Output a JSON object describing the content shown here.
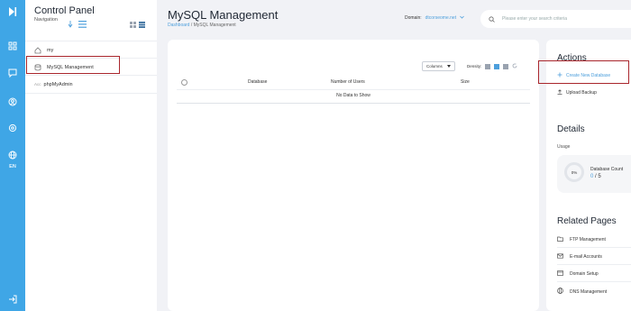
{
  "rail": {
    "items": [
      "expand-icon",
      "grid-icon",
      "chat-icon",
      "user-icon",
      "settings-icon",
      "globe-icon",
      "logout-icon"
    ],
    "lang": "EN"
  },
  "panel": {
    "title": "Control Panel",
    "nav_label": "Navigation",
    "items": [
      {
        "label": "my",
        "icon": "home-icon"
      },
      {
        "label": "MySQL Management",
        "icon": "database-icon"
      },
      {
        "label": "phpMyAdmin",
        "icon": "php-icon",
        "prefix": "Acc"
      }
    ]
  },
  "header": {
    "title": "MySQL Management",
    "breadcrumb": {
      "link": "Dashboard",
      "sep": " / ",
      "current": "MySQL Management"
    },
    "domain_label": "Domain:",
    "domain_value": "dtcorseome.net",
    "search_placeholder": "Please enter your search criteria"
  },
  "table": {
    "columns_button": "Columns",
    "density_label": "Density:",
    "headers": [
      "Database",
      "Number of Users",
      "Size"
    ],
    "empty_text": "No Data to Show"
  },
  "actions": {
    "heading": "Actions",
    "create": "Create New Database",
    "upload": "Upload Backup"
  },
  "details": {
    "heading": "Details",
    "usage_label": "Usage",
    "percent": "0%",
    "count_label": "Database Count",
    "used": "0",
    "sep": " / ",
    "limit": "5"
  },
  "related": {
    "heading": "Related Pages",
    "items": [
      {
        "label": "FTP Management",
        "icon": "folder-icon"
      },
      {
        "label": "E-mail Accounts",
        "icon": "mail-icon"
      },
      {
        "label": "Domain Setup",
        "icon": "domain-icon"
      },
      {
        "label": "DNS Management",
        "icon": "dns-icon"
      }
    ]
  },
  "colors": {
    "rail": "#3fa6e6",
    "accent": "#4d9fdc",
    "highlight": "#a9262c"
  }
}
